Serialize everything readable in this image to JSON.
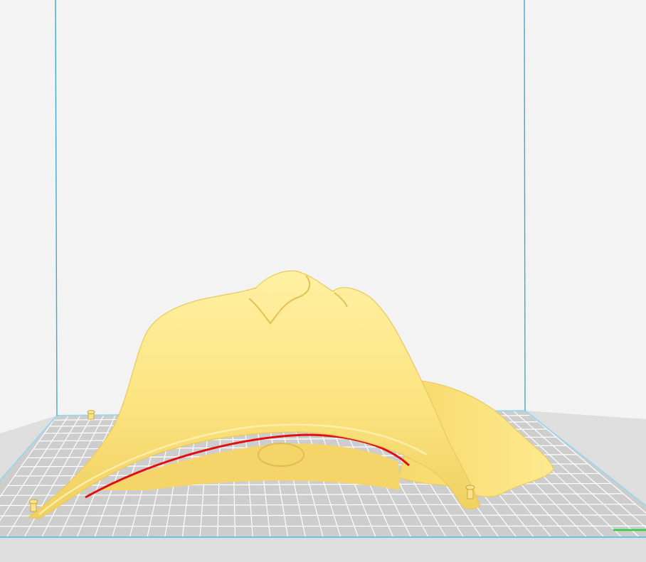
{
  "app": {
    "view": "3d-viewport",
    "model": {
      "kind": "face-mask",
      "color": "#fce88a",
      "overhang_color": "#e01010"
    },
    "build_plate": {
      "grid": true,
      "color": "#cfcfcf",
      "grid_color": "#ffffff"
    },
    "build_volume": {
      "edge_color": "#40a8cf"
    },
    "axis_indicator": {
      "color": "#30d040"
    }
  }
}
